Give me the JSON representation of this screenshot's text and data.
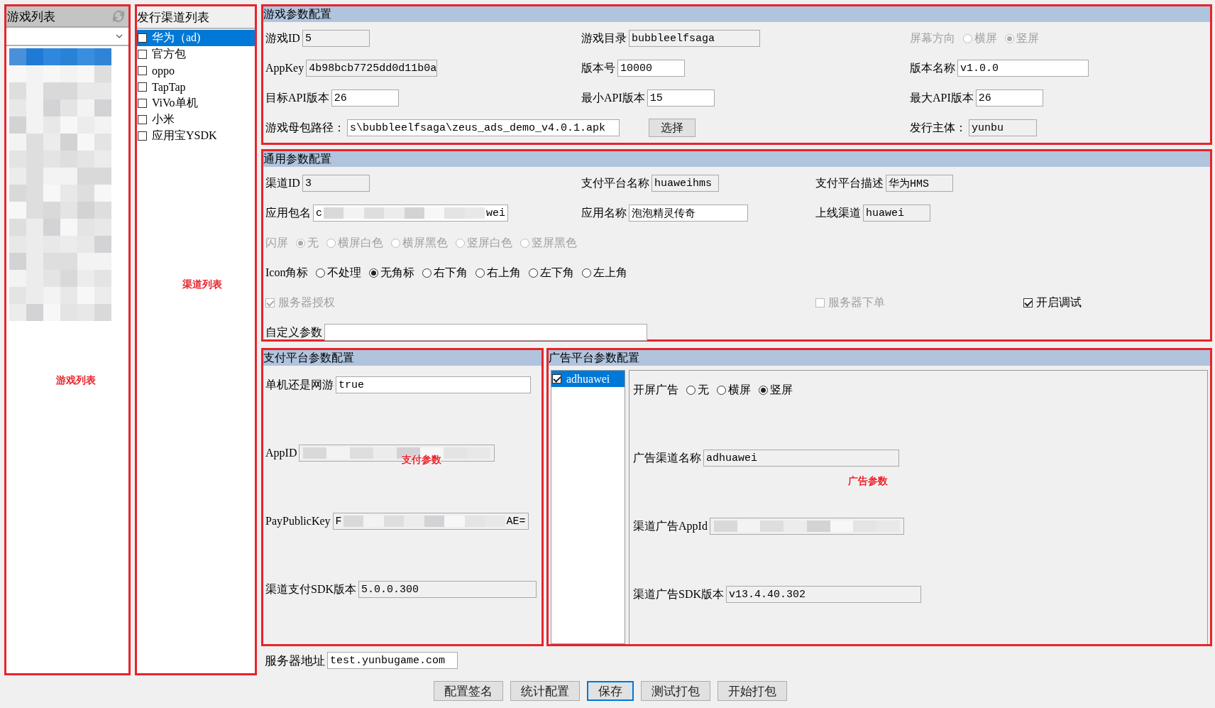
{
  "game_list": {
    "title": "游戏列表",
    "annotation": "游戏列表"
  },
  "channel_list": {
    "title": "发行渠道列表",
    "annotation": "渠道列表",
    "items": [
      {
        "label": "华为（ad)",
        "checked": false,
        "selected": true
      },
      {
        "label": "官方包",
        "checked": false,
        "selected": false
      },
      {
        "label": "oppo",
        "checked": false,
        "selected": false
      },
      {
        "label": "TapTap",
        "checked": false,
        "selected": false
      },
      {
        "label": "ViVo单机",
        "checked": false,
        "selected": false
      },
      {
        "label": "小米",
        "checked": false,
        "selected": false
      },
      {
        "label": "应用宝YSDK",
        "checked": false,
        "selected": false
      }
    ]
  },
  "game_params": {
    "title": "游戏参数配置",
    "rows": [
      [
        {
          "kind": "field",
          "label": "游戏ID",
          "value": "5",
          "readonly": true
        },
        {
          "kind": "field",
          "label": "游戏目录",
          "value": "bubbleelfsaga",
          "readonly": true
        },
        {
          "kind": "radio",
          "label": "屏幕方向",
          "disabled": true,
          "options": [
            {
              "label": "横屏",
              "selected": false
            },
            {
              "label": "竖屏",
              "selected": true
            }
          ]
        }
      ],
      [
        {
          "kind": "field",
          "label": "AppKey",
          "value": "4b98bcb7725dd0d11b0a",
          "readonly": true
        },
        {
          "kind": "field",
          "label": "版本号",
          "value": "10000",
          "readonly": false
        },
        {
          "kind": "field",
          "label": "版本名称",
          "value": "v1.0.0",
          "readonly": false
        }
      ],
      [
        {
          "kind": "field",
          "label": "目标API版本",
          "value": "26",
          "readonly": false
        },
        {
          "kind": "field",
          "label": "最小API版本",
          "value": "15",
          "readonly": false
        },
        {
          "kind": "field",
          "label": "最大API版本",
          "value": "26",
          "readonly": false
        }
      ],
      [
        {
          "kind": "field",
          "label": "游戏母包路径：",
          "value": "s\\bubbleelfsaga\\zeus_ads_demo_v4.0.1.apk",
          "readonly": false
        },
        {
          "kind": "button",
          "label": "选择"
        },
        {
          "kind": "field",
          "label": "发行主体：",
          "value": "yunbu",
          "readonly": true
        }
      ]
    ]
  },
  "general_params": {
    "title": "通用参数配置",
    "rows": [
      [
        {
          "kind": "field",
          "label": "渠道ID",
          "value": "3",
          "readonly": true
        },
        {
          "kind": "field",
          "label": "支付平台名称",
          "value": "huaweihms",
          "readonly": true
        },
        {
          "kind": "field",
          "label": "支付平台描述",
          "value": "华为HMS",
          "readonly": true
        }
      ],
      [
        {
          "kind": "field",
          "label": "应用包名",
          "value": "c",
          "value_end": "wei",
          "redacted": true,
          "readonly": false
        },
        {
          "kind": "field",
          "label": "应用名称",
          "value": "泡泡精灵传奇",
          "readonly": false
        },
        {
          "kind": "field",
          "label": "上线渠道",
          "value": "huawei",
          "readonly": true
        }
      ],
      [
        {
          "kind": "radio",
          "label": "闪屏",
          "disabled": true,
          "options": [
            {
              "label": "无",
              "selected": true
            },
            {
              "label": "横屏白色",
              "selected": false
            },
            {
              "label": "横屏黑色",
              "selected": false
            },
            {
              "label": "竖屏白色",
              "selected": false
            },
            {
              "label": "竖屏黑色",
              "selected": false
            }
          ]
        }
      ],
      [
        {
          "kind": "radio",
          "label": "Icon角标",
          "disabled": false,
          "options": [
            {
              "label": "不处理",
              "selected": false
            },
            {
              "label": "无角标",
              "selected": true
            },
            {
              "label": "右下角",
              "selected": false
            },
            {
              "label": "右上角",
              "selected": false
            },
            {
              "label": "左下角",
              "selected": false
            },
            {
              "label": "左上角",
              "selected": false
            }
          ]
        }
      ],
      [
        {
          "kind": "checkbox",
          "label": "服务器授权",
          "checked": true,
          "disabled": true
        },
        "",
        {
          "kind": "checkbox",
          "label": "服务器下单",
          "checked": false,
          "disabled": true
        },
        {
          "kind": "checkbox",
          "label": "开启调试",
          "checked": true,
          "disabled": false
        }
      ],
      [
        {
          "kind": "field",
          "label": "自定义参数",
          "readonly": false
        }
      ]
    ]
  },
  "payment_params": {
    "title": "支付平台参数配置",
    "annotation": "支付参数",
    "rows": [
      [
        {
          "kind": "field",
          "label": "单机还是网游",
          "value": "true",
          "readonly": false
        }
      ],
      [
        {
          "kind": "field",
          "label": "AppID",
          "redacted": true,
          "readonly": true
        }
      ],
      [
        {
          "kind": "field",
          "label": "PayPublicKey",
          "value": "F",
          "value_end": "AE=",
          "redacted": true,
          "readonly": true
        }
      ],
      [
        {
          "kind": "field",
          "label": "渠道支付SDK版本",
          "value": "5.0.0.300",
          "readonly": true
        }
      ]
    ]
  },
  "ad_params": {
    "title": "广告平台参数配置",
    "annotation": "广告参数",
    "platforms": [
      {
        "label": "adhuawei",
        "checked": true,
        "selected": true
      }
    ],
    "rows": [
      [
        {
          "kind": "radio",
          "label": "开屏广告",
          "disabled": false,
          "options": [
            {
              "label": "无",
              "selected": false
            },
            {
              "label": "横屏",
              "selected": false
            },
            {
              "label": "竖屏",
              "selected": true
            }
          ]
        }
      ],
      [
        {
          "kind": "field",
          "label": "广告渠道名称",
          "value": "adhuawei",
          "readonly": true
        }
      ],
      [
        {
          "kind": "field",
          "label": "渠道广告AppId",
          "redacted": true,
          "readonly": true
        }
      ],
      [
        {
          "kind": "field",
          "label": "渠道广告SDK版本",
          "value": "v13.4.40.302",
          "readonly": true
        }
      ]
    ]
  },
  "server": {
    "label": "服务器地址",
    "value": "test.yunbugame.com",
    "readonly": false
  },
  "buttons": [
    {
      "label": "配置签名",
      "focused": false
    },
    {
      "label": "统计配置",
      "focused": false
    },
    {
      "label": "保存",
      "focused": true
    },
    {
      "label": "测试打包",
      "focused": false
    },
    {
      "label": "开始打包",
      "focused": false
    }
  ]
}
